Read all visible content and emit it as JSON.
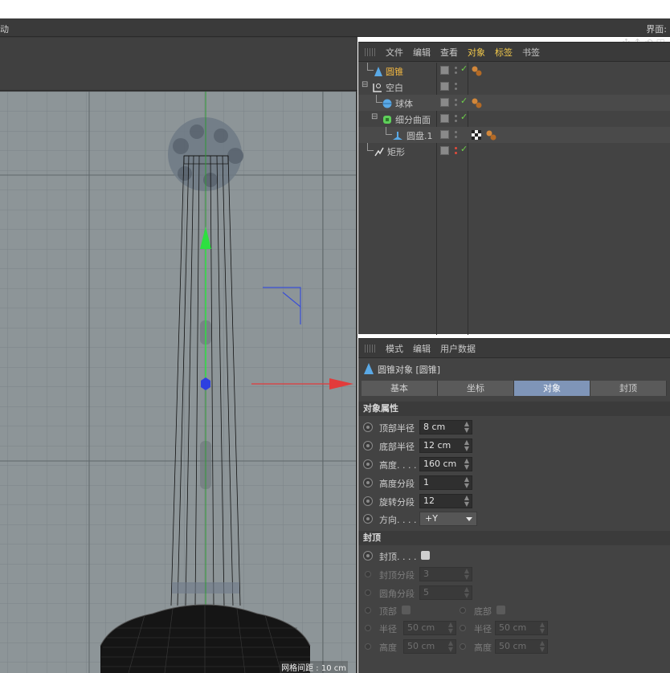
{
  "topbar": {
    "left_text": "动",
    "right_text": "界面: "
  },
  "viewport": {
    "grid_label": "网格间距 : 10 cm",
    "nav_icons": [
      "move-view-icon",
      "zoom-view-icon",
      "rotate-view-icon",
      "toggle-view-icon"
    ]
  },
  "object_manager": {
    "menu": [
      "文件",
      "编辑",
      "查看",
      "对象",
      "标签",
      "书签"
    ],
    "objects": [
      {
        "name": "圆锥",
        "icon": "cone-icon",
        "selected": true
      },
      {
        "name": "空白",
        "icon": "null-icon",
        "selected": false
      },
      {
        "name": "球体",
        "icon": "sphere-icon",
        "selected": false
      },
      {
        "name": "细分曲面",
        "icon": "subdivision-icon",
        "selected": false
      },
      {
        "name": "圆盘.1",
        "icon": "disc-icon",
        "selected": false
      },
      {
        "name": "矩形",
        "icon": "spline-icon",
        "selected": false
      }
    ]
  },
  "attribute_manager": {
    "menu": [
      "模式",
      "编辑",
      "用户数据"
    ],
    "object_title": "圆锥对象 [圆锥]",
    "tabs": [
      "基本",
      "坐标",
      "对象",
      "封顶"
    ],
    "active_tab": "对象",
    "section_object": "对象属性",
    "object_props": [
      {
        "label": "顶部半径",
        "value": "8 cm"
      },
      {
        "label": "底部半径",
        "value": "12 cm"
      },
      {
        "label": "高度. . . .",
        "value": "160 cm"
      },
      {
        "label": "高度分段",
        "value": "1"
      },
      {
        "label": "旋转分段",
        "value": "12"
      }
    ],
    "direction": {
      "label": "方向. . . .",
      "value": "+Y"
    },
    "section_caps": "封顶",
    "caps_label": "封顶. . . .",
    "cap_segments": {
      "label": "封顶分段",
      "value": "3"
    },
    "fillet_segments": {
      "label": "圆角分段",
      "value": "5"
    },
    "top_label": "顶部",
    "bottom_label": "底部",
    "radius_left": {
      "label": "半径",
      "value": "50 cm"
    },
    "radius_right": {
      "label": "半径",
      "value": "50 cm"
    },
    "height_left": {
      "label": "高度",
      "value": "50 cm"
    },
    "height_right": {
      "label": "高度",
      "value": "50 cm"
    }
  }
}
